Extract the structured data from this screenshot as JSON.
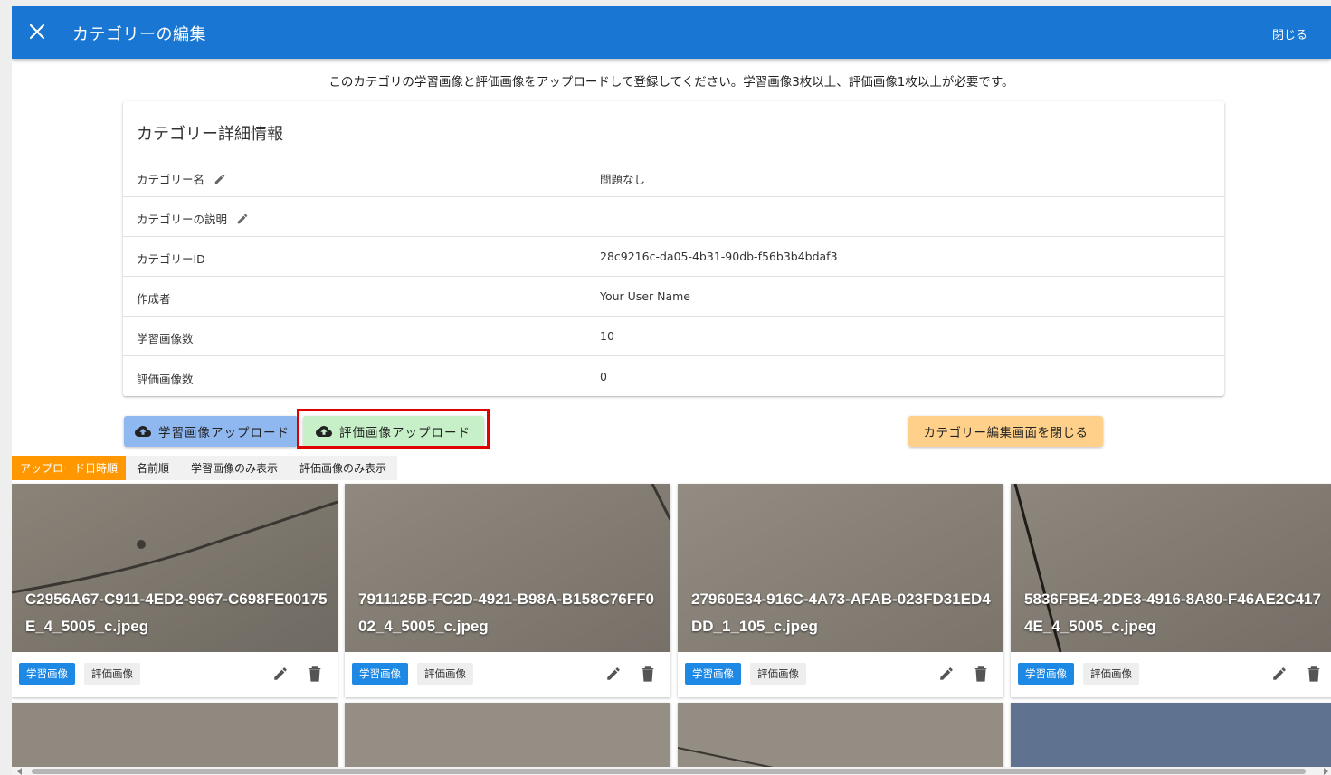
{
  "header": {
    "title": "カテゴリーの編集",
    "close_label": "閉じる"
  },
  "instruction": "このカテゴリの学習画像と評価画像をアップロードして登録してください。学習画像3枚以上、評価画像1枚以上が必要です。",
  "details": {
    "title": "カテゴリー詳細情報",
    "rows": [
      {
        "label": "カテゴリー名",
        "value": "問題なし",
        "editable": true
      },
      {
        "label": "カテゴリーの説明",
        "value": "",
        "editable": true
      },
      {
        "label": "カテゴリーID",
        "value": "28c9216c-da05-4b31-90db-f56b3b4bdaf3",
        "editable": false
      },
      {
        "label": "作成者",
        "value": "Your User Name",
        "editable": false
      },
      {
        "label": "学習画像数",
        "value": "10",
        "editable": false
      },
      {
        "label": "評価画像数",
        "value": "0",
        "editable": false
      }
    ]
  },
  "buttons": {
    "upload_train": "学習画像アップロード",
    "upload_eval": "評価画像アップロード",
    "close_edit": "カテゴリー編集画面を閉じる"
  },
  "sort": [
    "アップロード日時順",
    "名前順",
    "学習画像のみ表示",
    "評価画像のみ表示"
  ],
  "chips": {
    "train": "学習画像",
    "eval": "評価画像"
  },
  "images": [
    {
      "filename": "C2956A67-C911-4ED2-9967-C698FE00175E_4_5005_c.jpeg"
    },
    {
      "filename": "7911125B-FC2D-4921-B98A-B158C76FF002_4_5005_c.jpeg"
    },
    {
      "filename": "27960E34-916C-4A73-AFAB-023FD31ED4DD_1_105_c.jpeg"
    },
    {
      "filename": "5836FBE4-2DE3-4916-8A80-F46AE2C4174E_4_5005_c.jpeg"
    }
  ],
  "colors": {
    "appbar": "#1976d2",
    "train_button": "#90b8f0",
    "eval_button": "#c7f0c9",
    "close_button": "#ffd08a",
    "sort_active": "#ff9800",
    "chip_train": "#1e88e5",
    "highlight": "#e00000"
  }
}
